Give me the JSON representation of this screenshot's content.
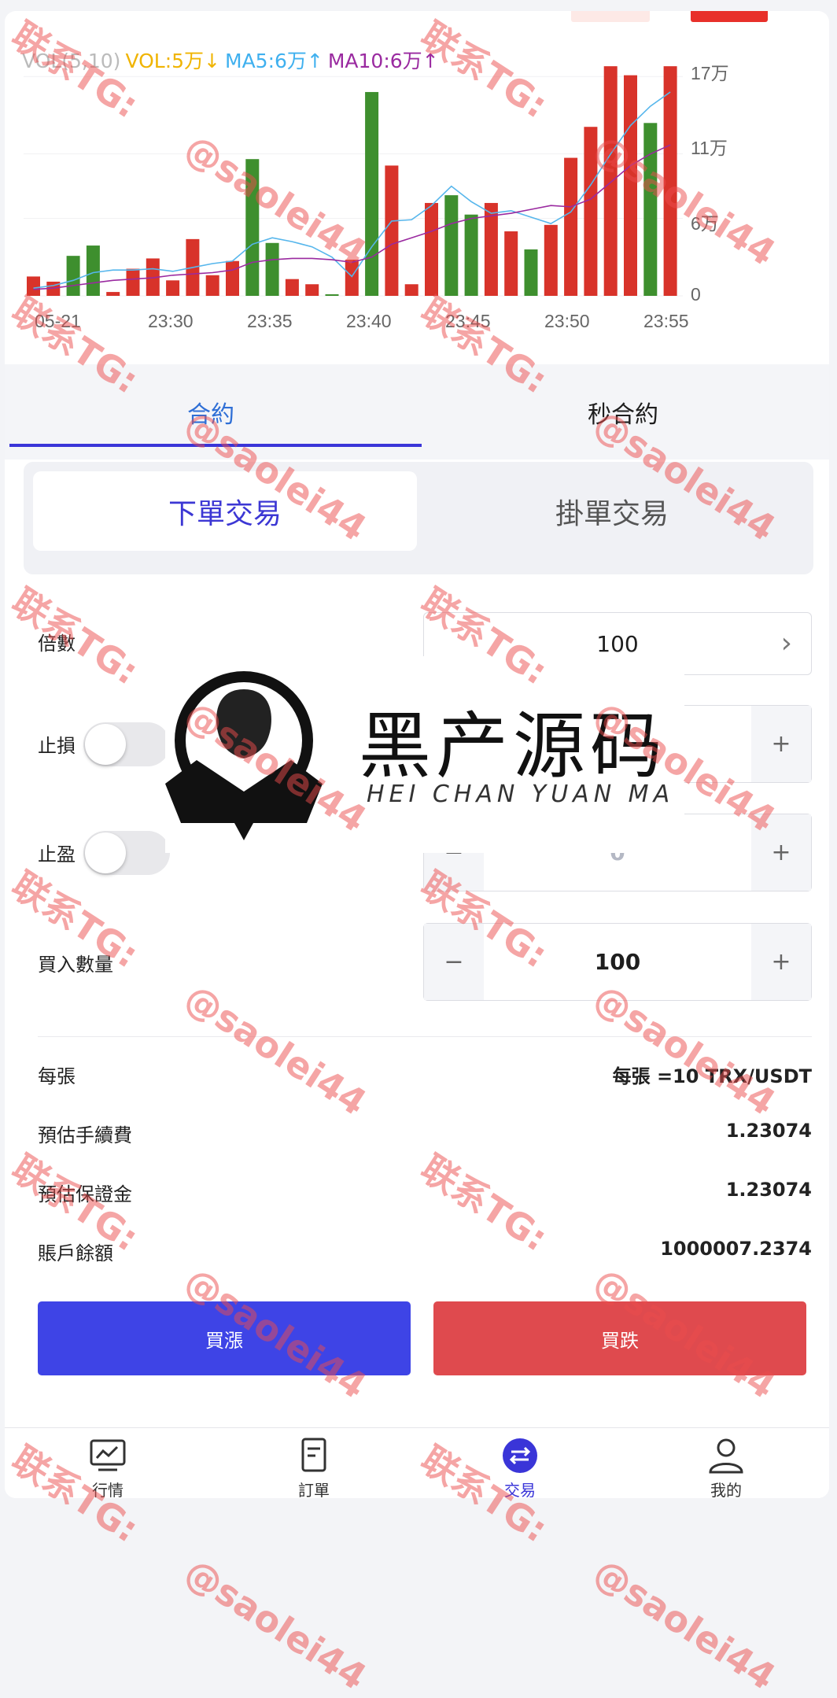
{
  "chart": {
    "legend": {
      "vol": "VOL(5,10)",
      "vol_val": "VOL:5万↓",
      "ma5": "MA5:6万↑",
      "ma10": "MA10:6万↑"
    },
    "y_ticks": [
      "17万",
      "11万",
      "6万",
      "0"
    ],
    "x_ticks": [
      "05-21",
      "23:30",
      "23:35",
      "23:40",
      "23:45",
      "23:50",
      "23:55"
    ],
    "colors": {
      "up": "#3e8f2e",
      "down": "#d8332a",
      "ma5": "#56b6ec",
      "ma10": "#9a2aa0",
      "vol_text": "#f0b400",
      "ma5_text": "#3fb0ef",
      "ma10_text": "#9a2aa0"
    }
  },
  "chart_data": {
    "type": "bar",
    "ylabel": "",
    "ylim": [
      0,
      170000
    ],
    "bars": [
      {
        "v": 15000,
        "c": "down"
      },
      {
        "v": 11000,
        "c": "down"
      },
      {
        "v": 31000,
        "c": "up"
      },
      {
        "v": 39000,
        "c": "up"
      },
      {
        "v": 3000,
        "c": "down"
      },
      {
        "v": 21000,
        "c": "down"
      },
      {
        "v": 29000,
        "c": "down"
      },
      {
        "v": 12000,
        "c": "down"
      },
      {
        "v": 44000,
        "c": "down"
      },
      {
        "v": 16000,
        "c": "down"
      },
      {
        "v": 27000,
        "c": "down"
      },
      {
        "v": 106000,
        "c": "up"
      },
      {
        "v": 41000,
        "c": "up"
      },
      {
        "v": 13000,
        "c": "down"
      },
      {
        "v": 9000,
        "c": "down"
      },
      {
        "v": 1000,
        "c": "up"
      },
      {
        "v": 28000,
        "c": "down"
      },
      {
        "v": 158000,
        "c": "up"
      },
      {
        "v": 101000,
        "c": "down"
      },
      {
        "v": 9000,
        "c": "down"
      },
      {
        "v": 72000,
        "c": "down"
      },
      {
        "v": 78000,
        "c": "up"
      },
      {
        "v": 63000,
        "c": "up"
      },
      {
        "v": 72000,
        "c": "down"
      },
      {
        "v": 50000,
        "c": "down"
      },
      {
        "v": 36000,
        "c": "up"
      },
      {
        "v": 55000,
        "c": "down"
      },
      {
        "v": 107000,
        "c": "down"
      },
      {
        "v": 131000,
        "c": "down"
      },
      {
        "v": 178000,
        "c": "down"
      },
      {
        "v": 171000,
        "c": "down"
      },
      {
        "v": 134000,
        "c": "up"
      },
      {
        "v": 178000,
        "c": "down"
      }
    ],
    "series": [
      {
        "name": "MA5",
        "values": [
          6000,
          8000,
          12000,
          18000,
          20000,
          20000,
          21000,
          19000,
          22000,
          25000,
          27000,
          40000,
          45000,
          42000,
          38000,
          30000,
          15000,
          38000,
          58000,
          59000,
          70000,
          85000,
          73000,
          64000,
          66000,
          61000,
          56000,
          65000,
          86000,
          110000,
          132000,
          147000,
          158000
        ]
      },
      {
        "name": "MA10",
        "values": [
          5000,
          6000,
          8000,
          10000,
          12000,
          13000,
          14000,
          16000,
          17000,
          18000,
          20000,
          26000,
          28000,
          29000,
          29000,
          28000,
          26000,
          30000,
          40000,
          45000,
          50000,
          56000,
          60000,
          62000,
          64000,
          67000,
          70000,
          69000,
          75000,
          88000,
          101000,
          110000,
          117000
        ]
      }
    ]
  },
  "tabs": {
    "contract": "合約",
    "second_contract": "秒合約"
  },
  "order_type": {
    "market": "下單交易",
    "limit": "掛單交易"
  },
  "form": {
    "leverage_label": "倍數",
    "leverage_value": "100",
    "leverage_arrow": "›",
    "stop_loss_label": "止損",
    "take_profit_label": "止盈",
    "take_profit_value": "0",
    "quantity_label": "買入數量",
    "quantity_value": "100",
    "minus": "−",
    "plus": "+"
  },
  "info": {
    "per_contract_label": "每張",
    "per_contract_value": "每張 =10 TRX/USDT",
    "fee_label": "預估手續費",
    "fee_value": "1.23074",
    "margin_label": "預估保證金",
    "margin_value": "1.23074",
    "balance_label": "賬戶餘額",
    "balance_value": "1000007.2374"
  },
  "actions": {
    "buy_up": "買漲",
    "buy_down": "買跌"
  },
  "nav": {
    "market": "行情",
    "orders": "訂單",
    "trade": "交易",
    "mine": "我的"
  },
  "overlays": {
    "watermark_contact": "联系TG:",
    "watermark_handle": "@saolei44",
    "brand_cn": "黑产源码",
    "brand_en": "HEI CHAN YUAN MA"
  }
}
